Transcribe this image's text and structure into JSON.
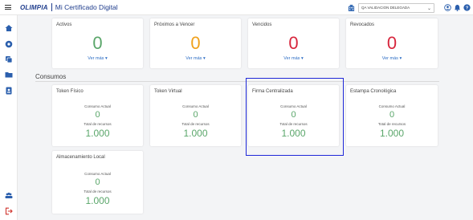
{
  "header": {
    "logo_text": "OLIMPIA",
    "app_title": "Mi Certificado Digital",
    "org_select": "QA VALIDACION DELEGADA"
  },
  "icons": {
    "menu": "hamburger-icon",
    "building": "building-icon",
    "user": "user-circle-icon",
    "bell": "bell-icon",
    "help": "help-icon",
    "sidebar": [
      "home-icon",
      "settings-icon",
      "copy-icon",
      "folder-icon",
      "id-card-icon",
      "users-icon",
      "logout-icon"
    ]
  },
  "colors": {
    "accent": "#2b6cc4",
    "green": "#5aa66a",
    "orange": "#f0a11c",
    "red": "#d7263d",
    "highlight": "#1f28d8"
  },
  "status_cards": [
    {
      "title": "Activos",
      "value": "0",
      "more": "Ver más"
    },
    {
      "title": "Próximos a Vencer",
      "value": "0",
      "more": "Ver más"
    },
    {
      "title": "Vencidos",
      "value": "0",
      "more": "Ver más"
    },
    {
      "title": "Revocados",
      "value": "0",
      "more": "Ver más"
    }
  ],
  "consumos": {
    "title": "Consumos",
    "current_label": "Consumo Actual",
    "total_label": "Total de recursos",
    "cards": [
      {
        "title": "Token Físico",
        "current": "0",
        "total": "1.000"
      },
      {
        "title": "Token Virtual",
        "current": "0",
        "total": "1.000"
      },
      {
        "title": "Firma Centralizada",
        "current": "0",
        "total": "1.000"
      },
      {
        "title": "Estampa Cronológica",
        "current": "0",
        "total": "1.000"
      },
      {
        "title": "Almacenamiento Local",
        "current": "0",
        "total": "1.000"
      }
    ]
  }
}
